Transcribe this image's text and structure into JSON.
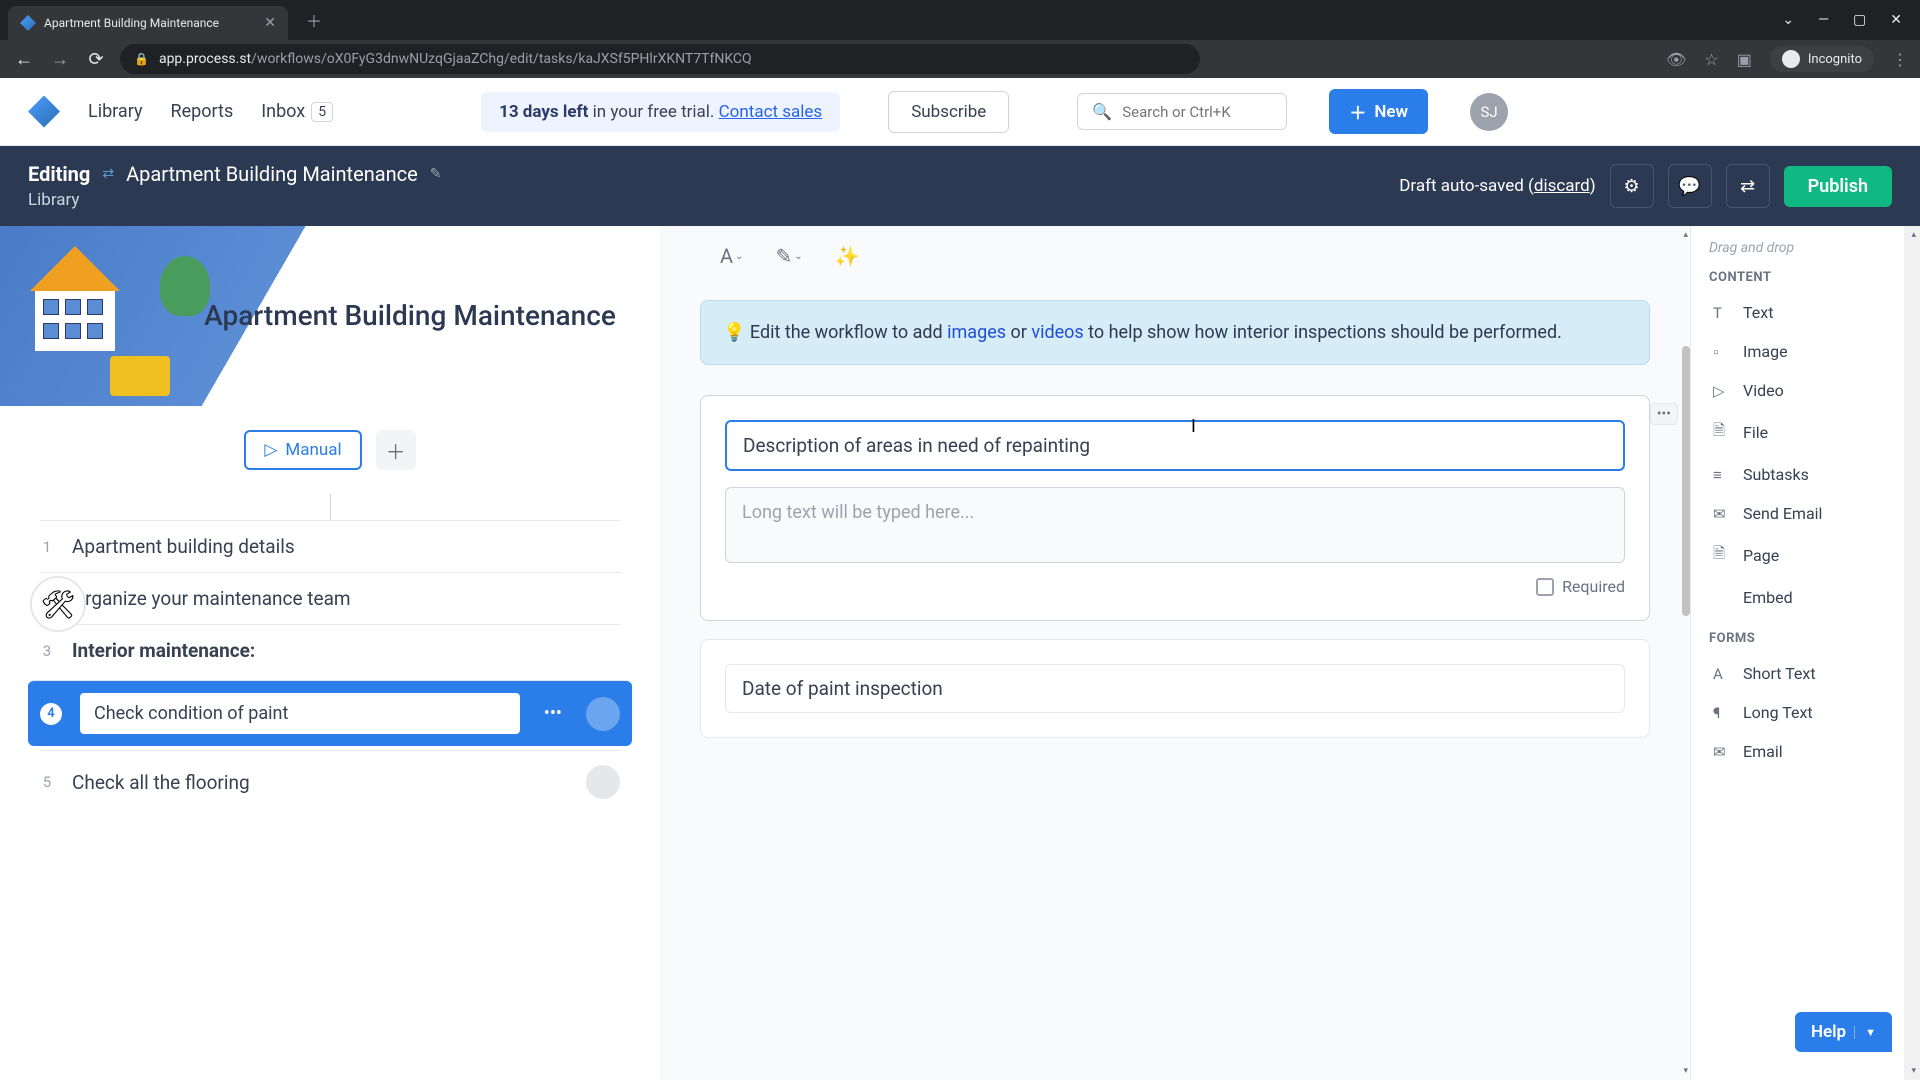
{
  "browser": {
    "tab_title": "Apartment Building Maintenance",
    "url_domain": "app.process.st",
    "url_path": "/workflows/oX0FyG3dnwNUzqGjaaZChg/edit/tasks/kaJXSf5PHlrXKNT7TfNKCQ",
    "incognito_label": "Incognito"
  },
  "header": {
    "nav": {
      "library": "Library",
      "reports": "Reports",
      "inbox": "Inbox",
      "inbox_count": "5"
    },
    "trial": {
      "days": "13 days left",
      "suffix": " in your free trial.  ",
      "contact": "Contact sales"
    },
    "subscribe": "Subscribe",
    "search_placeholder": "Search or Ctrl+K",
    "new_label": "New",
    "avatar_initials": "SJ"
  },
  "editing_bar": {
    "prefix": "Editing",
    "title": "Apartment Building Maintenance",
    "breadcrumb": "Library",
    "draft_text": "Draft auto-saved (",
    "discard": "discard",
    "draft_close": ")",
    "publish": "Publish"
  },
  "left": {
    "hero_title": "Apartment Building Maintenance",
    "manual": "Manual",
    "tasks": [
      {
        "num": "1",
        "label": "Apartment building details"
      },
      {
        "num": "2",
        "label": "Organize your maintenance team"
      },
      {
        "num": "3",
        "label": "Interior maintenance:",
        "heading": true
      },
      {
        "num": "4",
        "label": "Check condition of paint",
        "selected": true
      },
      {
        "num": "5",
        "label": "Check all the flooring"
      }
    ]
  },
  "center": {
    "info": {
      "prefix": "💡 Edit the workflow to add ",
      "link1": "images",
      "mid": " or ",
      "link2": "videos",
      "suffix": " to help show how interior inspections should be performed."
    },
    "field1": {
      "label_value": "Description of areas in need of repainting",
      "placeholder": "Long text will be typed here...",
      "required_label": "Required"
    },
    "field2": {
      "label_value": "Date of paint inspection"
    }
  },
  "right": {
    "drag_label": "Drag and drop",
    "content_head": "CONTENT",
    "forms_head": "FORMS",
    "content_items": [
      {
        "icon": "T",
        "label": "Text"
      },
      {
        "icon": "▫",
        "label": "Image"
      },
      {
        "icon": "▷",
        "label": "Video"
      },
      {
        "icon": "🗎",
        "label": "File"
      },
      {
        "icon": "≡",
        "label": "Subtasks"
      },
      {
        "icon": "✉",
        "label": "Send Email"
      },
      {
        "icon": "🗎",
        "label": "Page"
      },
      {
        "icon": "</>",
        "label": "Embed"
      }
    ],
    "form_items": [
      {
        "icon": "A",
        "label": "Short Text"
      },
      {
        "icon": "¶",
        "label": "Long Text"
      },
      {
        "icon": "✉",
        "label": "Email"
      }
    ]
  },
  "help": {
    "label": "Help"
  }
}
